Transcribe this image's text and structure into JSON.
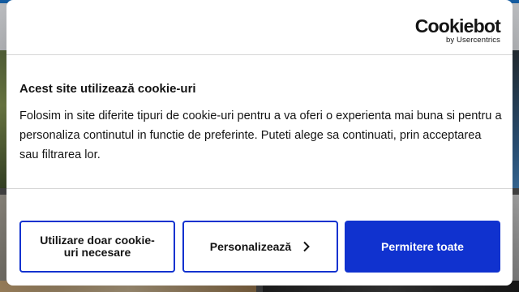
{
  "brand": {
    "logo_main": "Cookiebot",
    "logo_sub": "by Usercentrics",
    "accent_color": "#1032cf"
  },
  "dialog": {
    "title": "Acest site utilizează cookie-uri",
    "body": "Folosim in site diferite tipuri de cookie-uri pentru a va oferi o experienta mai buna si pentru a personaliza continutul in functie de preferinte. Puteti alege sa continuati, prin acceptarea sau filtrarea lor."
  },
  "buttons": {
    "necessary_label": "Utilizare doar cookie-uri necesare",
    "customize_label": "Personalizează",
    "allow_all_label": "Permitere toate"
  },
  "icons": {
    "customize": "chevron-right-icon"
  }
}
